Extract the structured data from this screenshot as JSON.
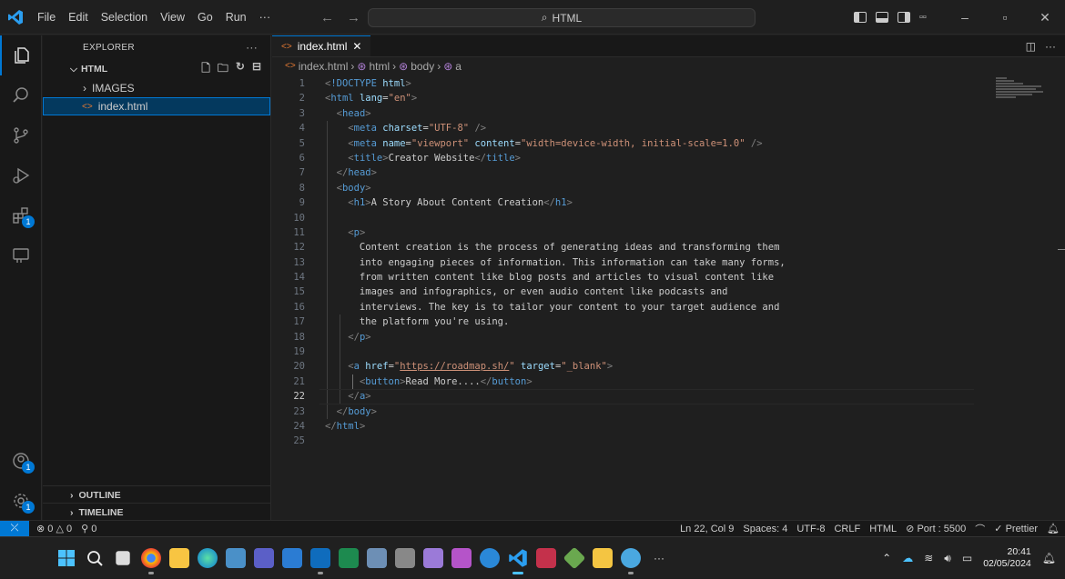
{
  "menu": {
    "items": [
      "File",
      "Edit",
      "Selection",
      "View",
      "Go",
      "Run",
      "···"
    ]
  },
  "search": {
    "text": "HTML"
  },
  "sidebar": {
    "title": "EXPLORER",
    "folder": "HTML",
    "items": [
      {
        "label": "IMAGES",
        "type": "folder"
      },
      {
        "label": "index.html",
        "type": "file",
        "selected": true
      }
    ],
    "sections": [
      "OUTLINE",
      "TIMELINE"
    ]
  },
  "activity": {
    "extensions_badge": "1",
    "accounts_badge": "1",
    "manage_badge": "1"
  },
  "editor": {
    "tab": "index.html",
    "breadcrumb": [
      "index.html",
      "html",
      "body",
      "a"
    ],
    "current_line": 22
  },
  "status": {
    "errors": "0",
    "warnings": "0",
    "ports": "0",
    "position": "Ln 22, Col 9",
    "spaces": "Spaces: 4",
    "encoding": "UTF-8",
    "eol": "CRLF",
    "language": "HTML",
    "port": "Port : 5500",
    "prettier": "Prettier"
  },
  "taskbar": {
    "time": "20:41",
    "date": "02/05/2024"
  },
  "colors": {
    "accent": "#0078d4",
    "tag": "#569cd6",
    "attr": "#9cdcfe",
    "string": "#ce9178",
    "text": "#cccccc"
  }
}
